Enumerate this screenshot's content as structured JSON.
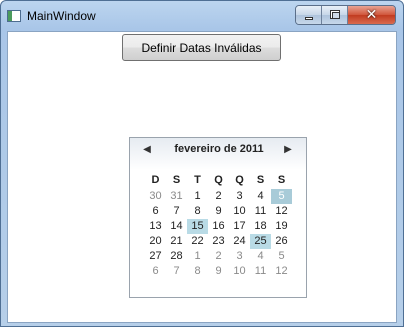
{
  "window": {
    "title": "MainWindow",
    "close_glyph": "✕"
  },
  "button": {
    "label": "Definir Datas Inválidas"
  },
  "calendar": {
    "month_label": "fevereiro de 2011",
    "prev_glyph": "◀",
    "next_glyph": "▶",
    "weekdays": [
      "D",
      "S",
      "T",
      "Q",
      "Q",
      "S",
      "S"
    ],
    "weeks": [
      [
        {
          "t": "30",
          "other": true
        },
        {
          "t": "31",
          "other": true
        },
        {
          "t": "1"
        },
        {
          "t": "2"
        },
        {
          "t": "3"
        },
        {
          "t": "4"
        },
        {
          "t": "5",
          "state": "selected"
        }
      ],
      [
        {
          "t": "6"
        },
        {
          "t": "7"
        },
        {
          "t": "8"
        },
        {
          "t": "9"
        },
        {
          "t": "10"
        },
        {
          "t": "11"
        },
        {
          "t": "12"
        }
      ],
      [
        {
          "t": "13"
        },
        {
          "t": "14"
        },
        {
          "t": "15",
          "state": "blackout"
        },
        {
          "t": "16"
        },
        {
          "t": "17"
        },
        {
          "t": "18"
        },
        {
          "t": "19"
        }
      ],
      [
        {
          "t": "20"
        },
        {
          "t": "21"
        },
        {
          "t": "22"
        },
        {
          "t": "23"
        },
        {
          "t": "24"
        },
        {
          "t": "25",
          "state": "blackout"
        },
        {
          "t": "26"
        }
      ],
      [
        {
          "t": "27"
        },
        {
          "t": "28"
        },
        {
          "t": "1",
          "other": true
        },
        {
          "t": "2",
          "other": true
        },
        {
          "t": "3",
          "other": true
        },
        {
          "t": "4",
          "other": true
        },
        {
          "t": "5",
          "other": true
        }
      ],
      [
        {
          "t": "6",
          "other": true
        },
        {
          "t": "7",
          "other": true
        },
        {
          "t": "8",
          "other": true
        },
        {
          "t": "9",
          "other": true
        },
        {
          "t": "10",
          "other": true
        },
        {
          "t": "11",
          "other": true
        },
        {
          "t": "12",
          "other": true
        }
      ]
    ]
  },
  "colors": {
    "selected": "#a8cbd8",
    "blackout": "#b9dbe6",
    "other_month_text": "#8a8a8a"
  }
}
